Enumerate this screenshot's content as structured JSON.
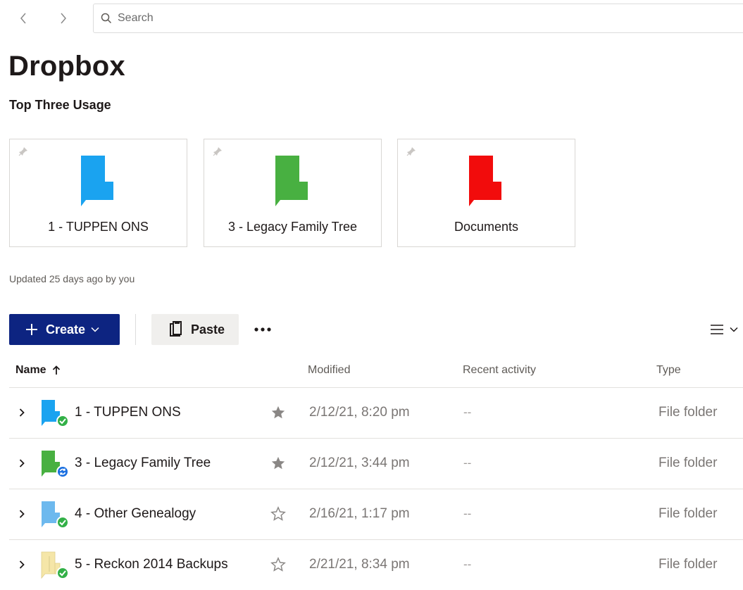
{
  "nav": {
    "back_icon": "chevron-left-icon",
    "forward_icon": "chevron-right-icon"
  },
  "search": {
    "placeholder": "Search",
    "value": "",
    "icon": "search-icon"
  },
  "page": {
    "title": "Dropbox"
  },
  "pinned": {
    "title": "Top Three Usage",
    "items": [
      {
        "label": "1 - TUPPEN ONS",
        "folder_color": "#1aa3f0",
        "icon": "pin-icon"
      },
      {
        "label": "3 - Legacy Family Tree",
        "folder_color": "#48b041",
        "icon": "pin-icon"
      },
      {
        "label": "Documents",
        "folder_color": "#f20c0c",
        "icon": "pin-icon"
      }
    ],
    "updated": "Updated 25 days ago by you"
  },
  "toolbar": {
    "create_label": "Create",
    "paste_label": "Paste",
    "more_icon": "more-horizontal-icon",
    "view_icon": "list-view-icon"
  },
  "table": {
    "columns": {
      "name": "Name",
      "modified": "Modified",
      "activity": "Recent activity",
      "type": "Type"
    },
    "sort": "ascending",
    "rows": [
      {
        "name": "1 - TUPPEN ONS",
        "modified": "2/12/21, 8:20 pm",
        "activity": "--",
        "type": "File folder",
        "folder_color": "#1aa3f0",
        "sync_status": "synced",
        "starred": true
      },
      {
        "name": "3 - Legacy Family Tree",
        "modified": "2/12/21, 3:44 pm",
        "activity": "--",
        "type": "File folder",
        "folder_color": "#48b041",
        "sync_status": "syncing",
        "starred": true
      },
      {
        "name": "4 - Other Genealogy",
        "modified": "2/16/21, 1:17 pm",
        "activity": "--",
        "type": "File folder",
        "folder_color": "#6db9ee",
        "sync_status": "synced",
        "starred": false
      },
      {
        "name": "5 - Reckon 2014 Backups",
        "modified": "2/21/21, 8:34 pm",
        "activity": "--",
        "type": "File folder",
        "folder_color": "#f5e6a8",
        "sync_status": "synced",
        "starred": false
      }
    ]
  },
  "colors": {
    "primary": "#0d2481",
    "synced": "#32b047",
    "syncing": "#1a6fe0"
  }
}
